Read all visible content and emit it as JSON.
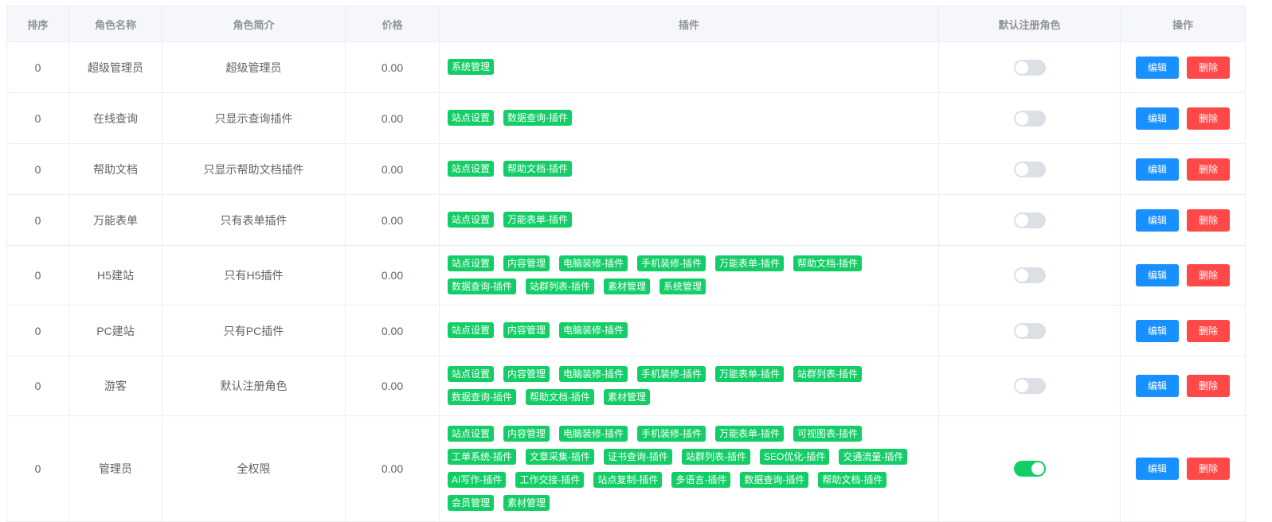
{
  "headers": [
    "排序",
    "角色名称",
    "角色简介",
    "价格",
    "插件",
    "默认注册角色",
    "操作"
  ],
  "buttons": {
    "edit": "编辑",
    "delete": "删除"
  },
  "rows": [
    {
      "sort": "0",
      "name": "超级管理员",
      "desc": "超级管理员",
      "price": "0.00",
      "plugins": [
        "系统管理"
      ],
      "default": false
    },
    {
      "sort": "0",
      "name": "在线查询",
      "desc": "只显示查询插件",
      "price": "0.00",
      "plugins": [
        "站点设置",
        "数据查询-插件"
      ],
      "default": false
    },
    {
      "sort": "0",
      "name": "帮助文档",
      "desc": "只显示帮助文档插件",
      "price": "0.00",
      "plugins": [
        "站点设置",
        "帮助文档-插件"
      ],
      "default": false
    },
    {
      "sort": "0",
      "name": "万能表单",
      "desc": "只有表单插件",
      "price": "0.00",
      "plugins": [
        "站点设置",
        "万能表单-插件"
      ],
      "default": false
    },
    {
      "sort": "0",
      "name": "H5建站",
      "desc": "只有H5插件",
      "price": "0.00",
      "plugins": [
        "站点设置",
        "内容管理",
        "电脑装修-插件",
        "手机装修-插件",
        "万能表单-插件",
        "帮助文档-插件",
        "数据查询-插件",
        "站群列表-插件",
        "素材管理",
        "系统管理"
      ],
      "default": false
    },
    {
      "sort": "0",
      "name": "PC建站",
      "desc": "只有PC插件",
      "price": "0.00",
      "plugins": [
        "站点设置",
        "内容管理",
        "电脑装修-插件"
      ],
      "default": false
    },
    {
      "sort": "0",
      "name": "游客",
      "desc": "默认注册角色",
      "price": "0.00",
      "plugins": [
        "站点设置",
        "内容管理",
        "电脑装修-插件",
        "手机装修-插件",
        "万能表单-插件",
        "站群列表-插件",
        "数据查询-插件",
        "帮助文档-插件",
        "素材管理"
      ],
      "default": false
    },
    {
      "sort": "0",
      "name": "管理员",
      "desc": "全权限",
      "price": "0.00",
      "plugins": [
        "站点设置",
        "内容管理",
        "电脑装修-插件",
        "手机装修-插件",
        "万能表单-插件",
        "可视图表-插件",
        "工单系统-插件",
        "文章采集-插件",
        "证书查询-插件",
        "站群列表-插件",
        "SEO优化-插件",
        "交通流量-插件",
        "AI写作-插件",
        "工作交接-插件",
        "站点复制-插件",
        "多语言-插件",
        "数据查询-插件",
        "帮助文档-插件",
        "会员管理",
        "素材管理"
      ],
      "default": true
    }
  ]
}
